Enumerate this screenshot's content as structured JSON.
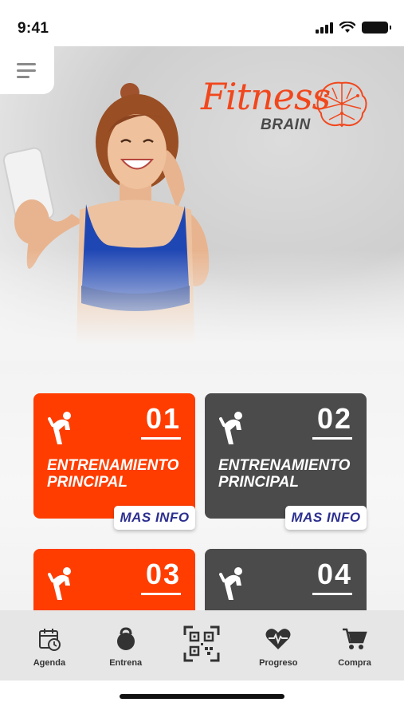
{
  "status_bar": {
    "time": "9:41"
  },
  "header": {
    "menu_icon": "hamburger-menu-icon"
  },
  "brand": {
    "word1": "Fitness",
    "word2": "BRAIN",
    "icon": "brain-icon",
    "accent_color": "#f1471d"
  },
  "cards": [
    {
      "number": "01",
      "title": "ENTRENAMIENTO PRINCIPAL",
      "info_label": "MAS  INFO",
      "color": "#ff3d00",
      "icon": "stretching-person-icon"
    },
    {
      "number": "02",
      "title": "ENTRENAMIENTO PRINCIPAL",
      "info_label": "MAS  INFO",
      "color": "#4b4b4b",
      "icon": "stretching-person-icon"
    },
    {
      "number": "03",
      "title": "",
      "info_label": "",
      "color": "#ff3d00",
      "icon": "stretching-person-icon"
    },
    {
      "number": "04",
      "title": "",
      "info_label": "",
      "color": "#4b4b4b",
      "icon": "stretching-person-icon"
    }
  ],
  "bottom_nav": {
    "items": [
      {
        "label": "Agenda",
        "icon": "calendar-clock-icon"
      },
      {
        "label": "Entrena",
        "icon": "kettlebell-icon"
      },
      {
        "label": "",
        "icon": "qr-code-icon"
      },
      {
        "label": "Progreso",
        "icon": "heart-pulse-icon"
      },
      {
        "label": "Compra",
        "icon": "cart-icon"
      }
    ]
  }
}
